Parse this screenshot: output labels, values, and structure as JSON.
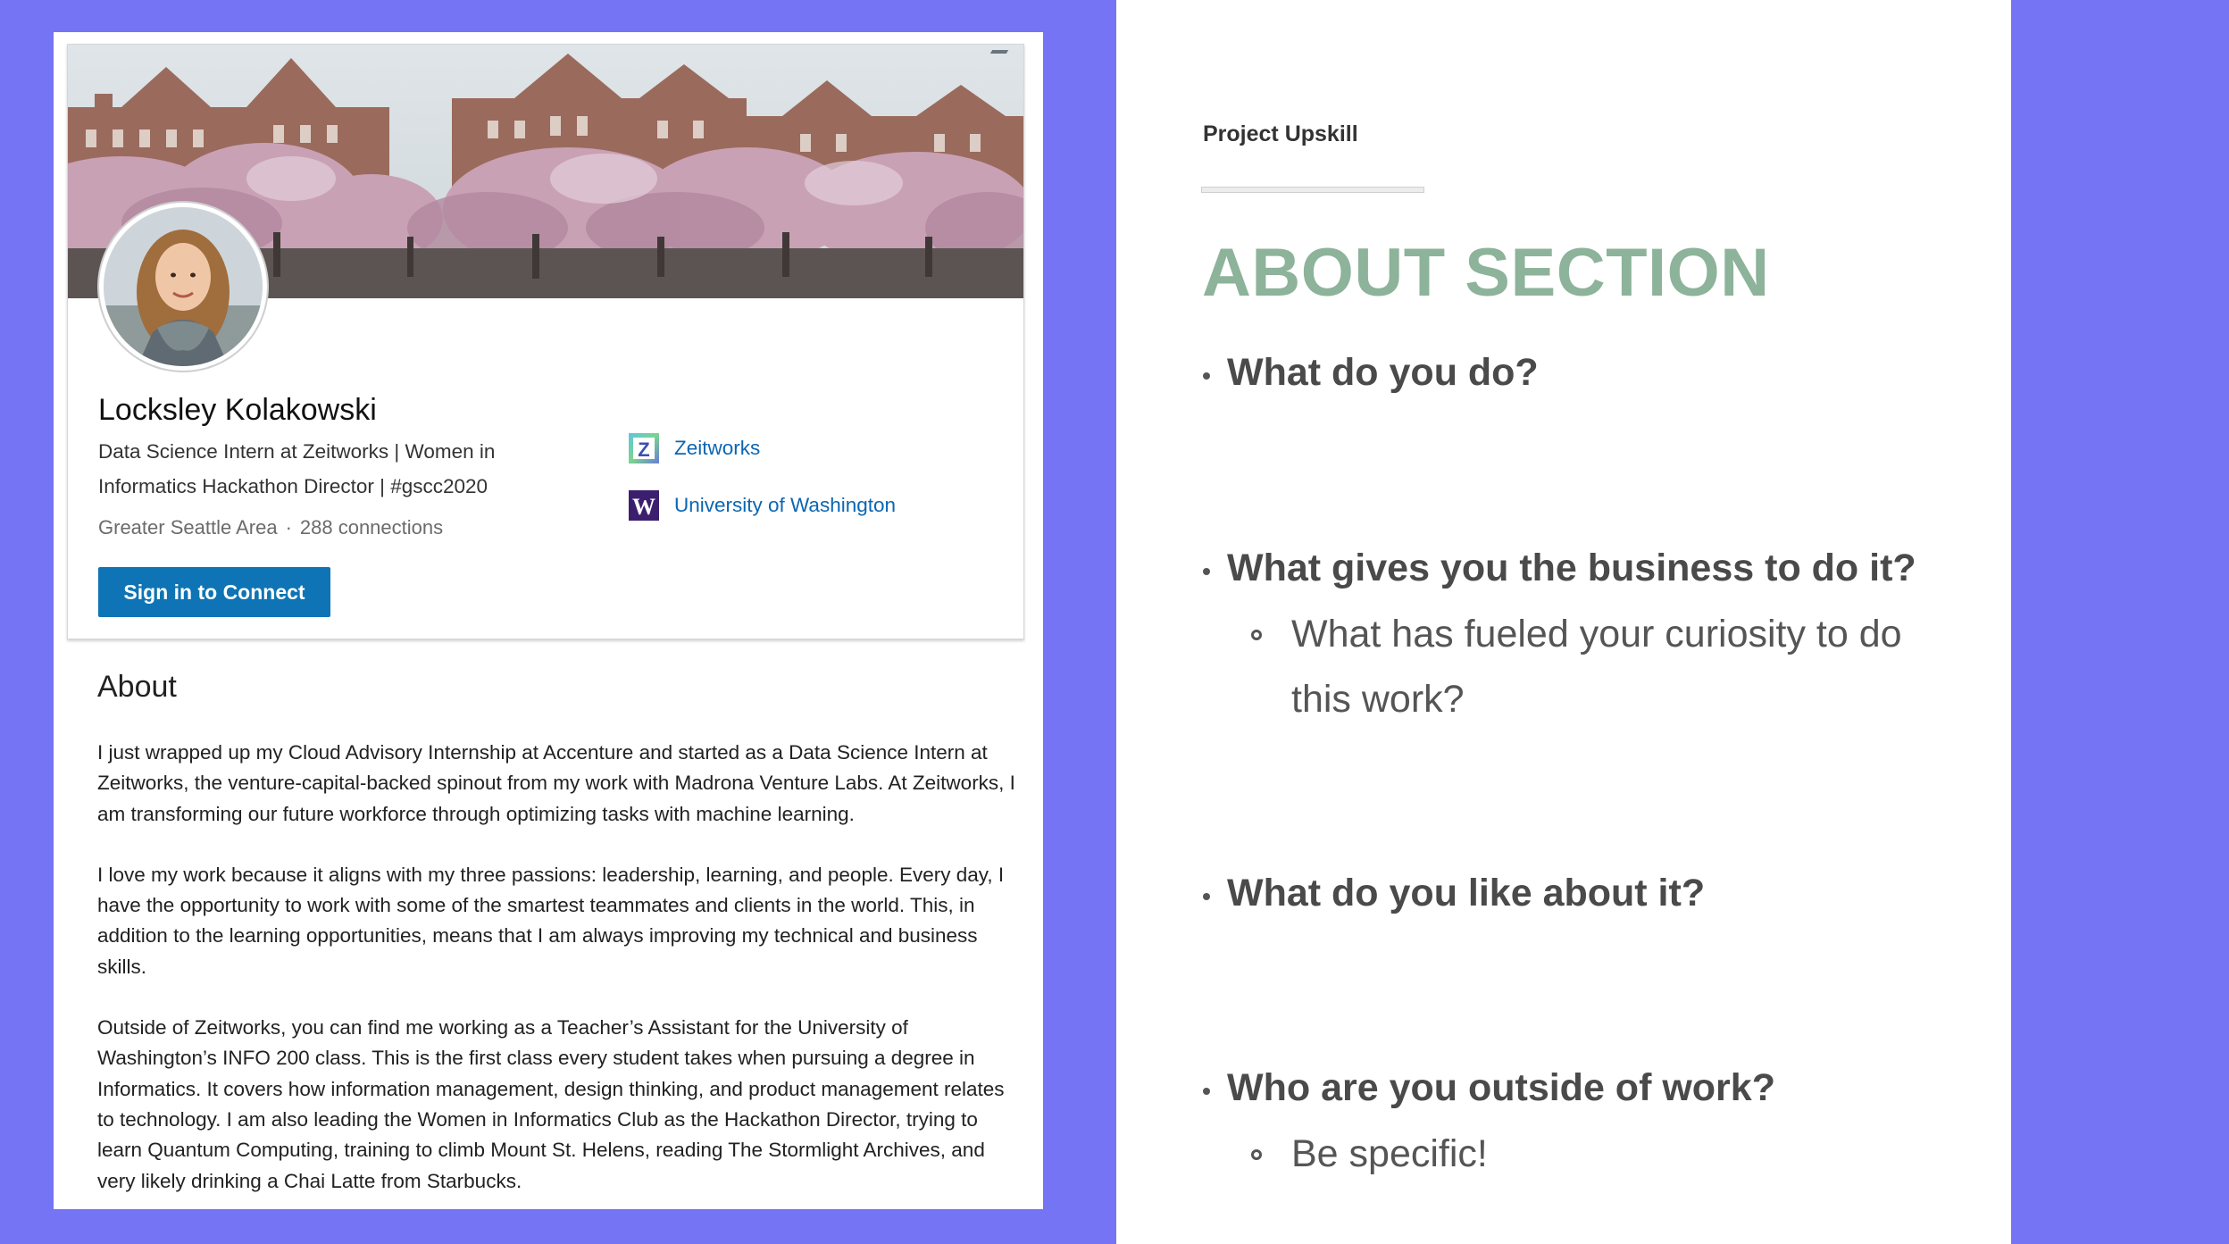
{
  "profile": {
    "name": "Locksley Kolakowski",
    "headline": "Data Science Intern at Zeitworks | Women in Informatics Hackathon Director | #gscc2020",
    "location": "Greater Seattle Area",
    "separator": "·",
    "connections": "288 connections",
    "connect_button": "Sign in to Connect",
    "orgs": [
      {
        "name": "Zeitworks",
        "logo_letter": "Z",
        "icon": "zeitworks-logo-icon"
      },
      {
        "name": "University of Washington",
        "logo_letter": "W",
        "icon": "uw-logo-icon"
      }
    ]
  },
  "about": {
    "title": "About",
    "paragraphs": [
      "I just wrapped up my Cloud Advisory Internship at Accenture and started as a Data Science Intern at Zeitworks, the venture-capital-backed spinout from my work with Madrona Venture Labs. At Zeitworks, I am transforming our future workforce through optimizing tasks with machine learning.",
      "I love my work because it aligns with my three passions: leadership, learning, and people. Every day, I have the opportunity to work with some of the smartest teammates and clients in the world. This, in addition to the learning opportunities, means that I am always improving my technical and business skills.",
      "Outside of Zeitworks, you can find me working as a Teacher’s Assistant for the University of Washington’s INFO 200 class. This is the first class every student takes when pursuing a degree in Informatics. It covers how information management, design thinking, and product management relates to technology. I am also leading the Women in Informatics Club as the Hackathon Director, trying to learn Quantum Computing, training to climb Mount St. Helens, reading The Stormlight Archives, and very likely drinking a Chai Latte from Starbucks."
    ]
  },
  "slide": {
    "brand": "Project Upskill",
    "title": "ABOUT SECTION",
    "questions": [
      "What do you do?",
      "What gives you the business to do it?",
      "What do you like about it?",
      "Who are you outside of work?"
    ],
    "subpoints": {
      "business": "What has fueled your curiosity to do this work?",
      "outside": "Be specific!"
    }
  },
  "colors": {
    "background": "#7474f4",
    "title_green": "#8db39a",
    "linkedin_blue": "#0e74b5",
    "link_blue": "#0b66b3"
  }
}
